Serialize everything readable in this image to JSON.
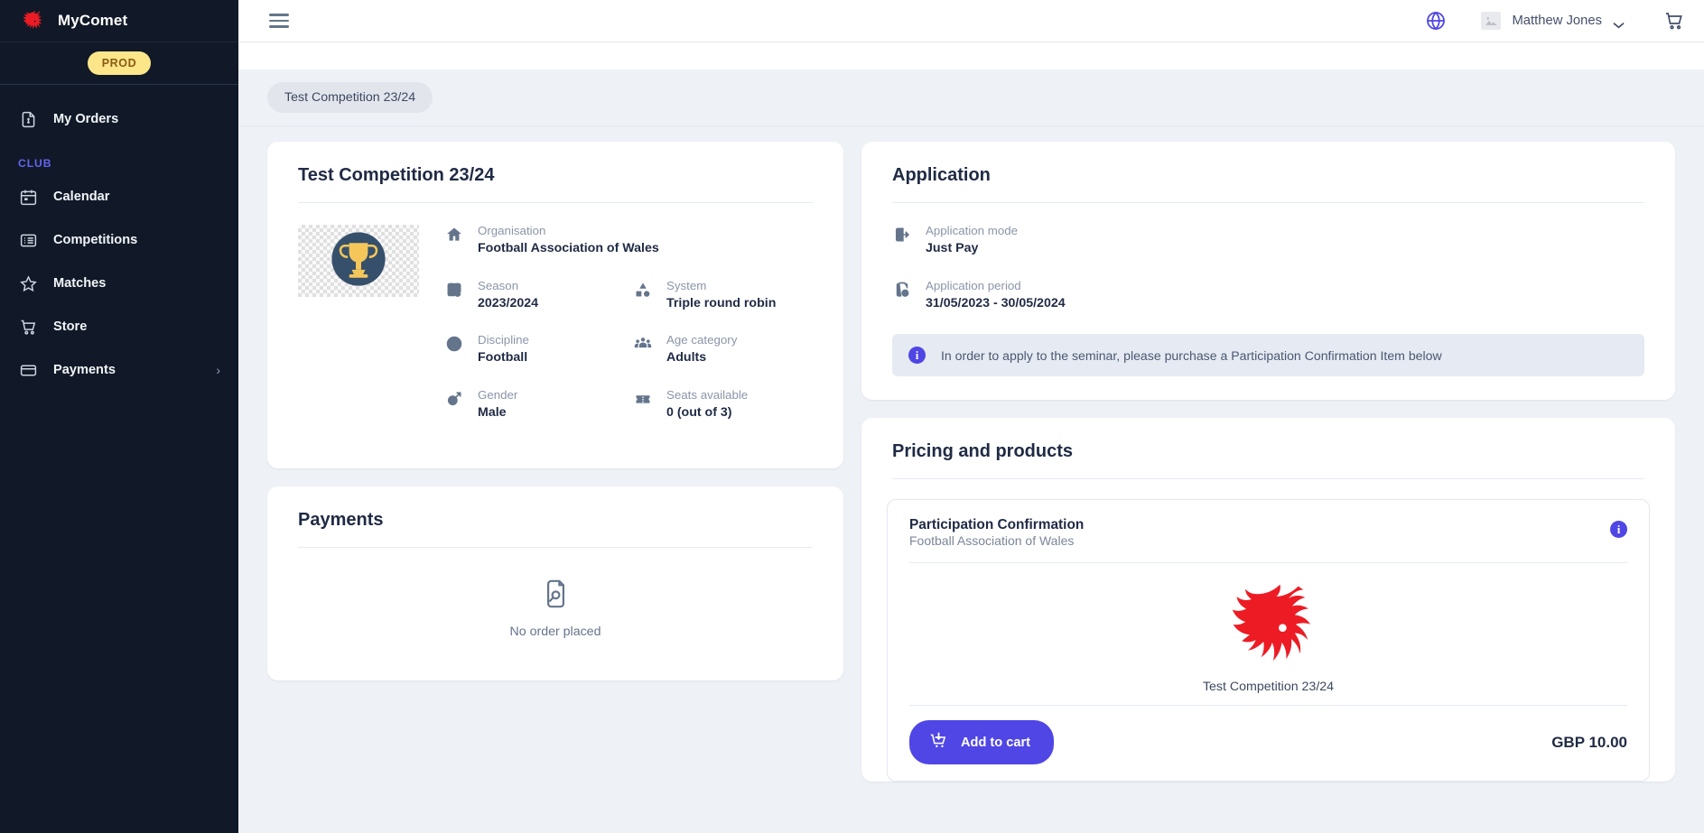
{
  "sidebar": {
    "brand": {
      "name": "MyComet",
      "logo_icon": "welsh-dragon-logo"
    },
    "env_badge": "PROD",
    "section_label": "CLUB",
    "top_items": [
      {
        "label": "My Orders",
        "icon": "document-invoice-icon"
      }
    ],
    "club_items": [
      {
        "label": "Calendar",
        "icon": "calendar-icon"
      },
      {
        "label": "Competitions",
        "icon": "list-icon"
      },
      {
        "label": "Matches",
        "icon": "star-icon"
      },
      {
        "label": "Store",
        "icon": "shopping-cart-icon"
      },
      {
        "label": "Payments",
        "icon": "credit-card-icon",
        "chevron": "›"
      }
    ]
  },
  "topbar": {
    "menu_icon": "hamburger-menu-icon",
    "language_icon": "globe-icon",
    "avatar_icon": "broken-image-placeholder-icon",
    "user_name": "Matthew Jones",
    "user_chevron_icon": "chevron-down-icon",
    "cart_icon": "shopping-cart-icon"
  },
  "breadcrumb": {
    "label": "Test Competition 23/24"
  },
  "competition_card": {
    "title": "Test Competition 23/24",
    "logo_icon": "trophy-icon",
    "facts": [
      {
        "label": "Organisation",
        "value": "Football Association of Wales",
        "icon": "home-icon",
        "full": true
      },
      {
        "label": "Season",
        "value": "2023/2024",
        "icon": "calendar-refresh-icon"
      },
      {
        "label": "System",
        "value": "Triple round robin",
        "icon": "shapes-icon"
      },
      {
        "label": "Discipline",
        "value": "Football",
        "icon": "football-icon"
      },
      {
        "label": "Age category",
        "value": "Adults",
        "icon": "people-group-icon"
      },
      {
        "label": "Gender",
        "value": "Male",
        "icon": "male-gender-icon"
      },
      {
        "label": "Seats available",
        "value": "0 (out of 3)",
        "icon": "ticket-icon"
      }
    ]
  },
  "payments_card": {
    "title": "Payments",
    "empty_icon": "no-order-document-icon",
    "empty_text": "No order placed"
  },
  "application_card": {
    "title": "Application",
    "facts": [
      {
        "label": "Application mode",
        "value": "Just Pay",
        "icon": "login-arrow-icon"
      },
      {
        "label": "Application period",
        "value": "31/05/2023 - 30/05/2024",
        "icon": "clipboard-clock-icon"
      }
    ],
    "notice": {
      "icon": "info-circle-icon",
      "icon_glyph": "i",
      "text": "In order to apply to the seminar, please purchase a Participation Confirmation Item below"
    }
  },
  "pricing_card": {
    "title": "Pricing and products",
    "product": {
      "name": "Participation Confirmation",
      "organisation": "Football Association of Wales",
      "info_icon": "info-circle-icon",
      "info_glyph": "i",
      "media_icon": "welsh-dragon-logo",
      "media_caption": "Test Competition 23/24",
      "add_to_cart_label": "Add to cart",
      "add_to_cart_icon": "add-to-cart-icon",
      "price": "GBP 10.00"
    }
  },
  "colors": {
    "sidebar_bg": "#111827",
    "accent_indigo": "#4f46e5",
    "env_badge_bg": "#fde68a",
    "dragon_red": "#ed1c24",
    "trophy_circle": "#36506b",
    "trophy_gold": "#f5c65a",
    "content_bg": "#eef1f6",
    "notice_bg": "#e6eaf2"
  }
}
